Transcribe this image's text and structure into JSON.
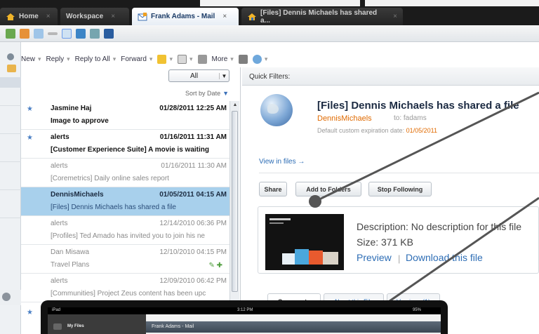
{
  "tabs": [
    {
      "label": "Home",
      "icon": "home-icon",
      "active": false
    },
    {
      "label": "Workspace",
      "icon": "",
      "active": false
    },
    {
      "label": "Frank Adams - Mail",
      "icon": "mail-icon",
      "active": true
    },
    {
      "label": "[Files] Dennis Michaels has shared a...",
      "icon": "home-icon",
      "active": false
    }
  ],
  "toolbar": {
    "new_label": "New",
    "reply_label": "Reply",
    "reply_all_label": "Reply to All",
    "forward_label": "Forward",
    "more_label": "More"
  },
  "list": {
    "filter_value": "All",
    "sort_label": "Sort by Date",
    "messages": [
      {
        "from": "Jasmine Haj",
        "date": "01/28/2011 12:25 AM",
        "subject": "Image to approve",
        "state": "unread"
      },
      {
        "from": "alerts",
        "date": "01/16/2011 11:31 AM",
        "subject": "[Customer Experience Suite] A movie is waiting",
        "state": "unread"
      },
      {
        "from": "alerts",
        "date": "01/16/2011 11:30 AM",
        "subject": "[Coremetrics] Daily online sales report",
        "state": "read"
      },
      {
        "from": "DennisMichaels",
        "date": "01/05/2011 04:15 AM",
        "subject": "[Files] Dennis Michaels has shared a file",
        "state": "selected"
      },
      {
        "from": "alerts",
        "date": "12/14/2010 06:36 PM",
        "subject": "[Profiles] Ted Amado has invited you to join his ne",
        "state": "read"
      },
      {
        "from": "Dan Misawa",
        "date": "12/10/2010 04:15 PM",
        "subject": "Travel Plans",
        "state": "read"
      },
      {
        "from": "alerts",
        "date": "12/09/2010 06:42 PM",
        "subject": "[Communities] Project Zeus content has been upc",
        "state": "read"
      }
    ]
  },
  "pane": {
    "quick_filters": "Quick Filters:",
    "subject": "[Files] Dennis Michaels has shared a file",
    "sender": "DennisMichaels",
    "to": "to: fadams",
    "expiry_label": "Default custom expiration date:",
    "expiry_date": "01/05/2011",
    "view_in_files": "View in files →",
    "buttons": {
      "share": "Share",
      "add_to_folders": "Add to Folders",
      "stop_following": "Stop Following"
    },
    "file": {
      "description": "Description: No description for this file",
      "size": "Size: 371 KB",
      "preview": "Preview",
      "download": "Download this file"
    },
    "tabs": [
      "Comments",
      "About this File",
      "Versions (1)"
    ]
  },
  "ipad": {
    "carrier": "iPad",
    "time": "3:12 PM",
    "battery": "95%",
    "side_title": "My Files",
    "main_title": "Frank Adams - Mail"
  },
  "colors": {
    "selected_row": "#a8d0ec",
    "link": "#2d6db5",
    "sender": "#e06a00"
  }
}
